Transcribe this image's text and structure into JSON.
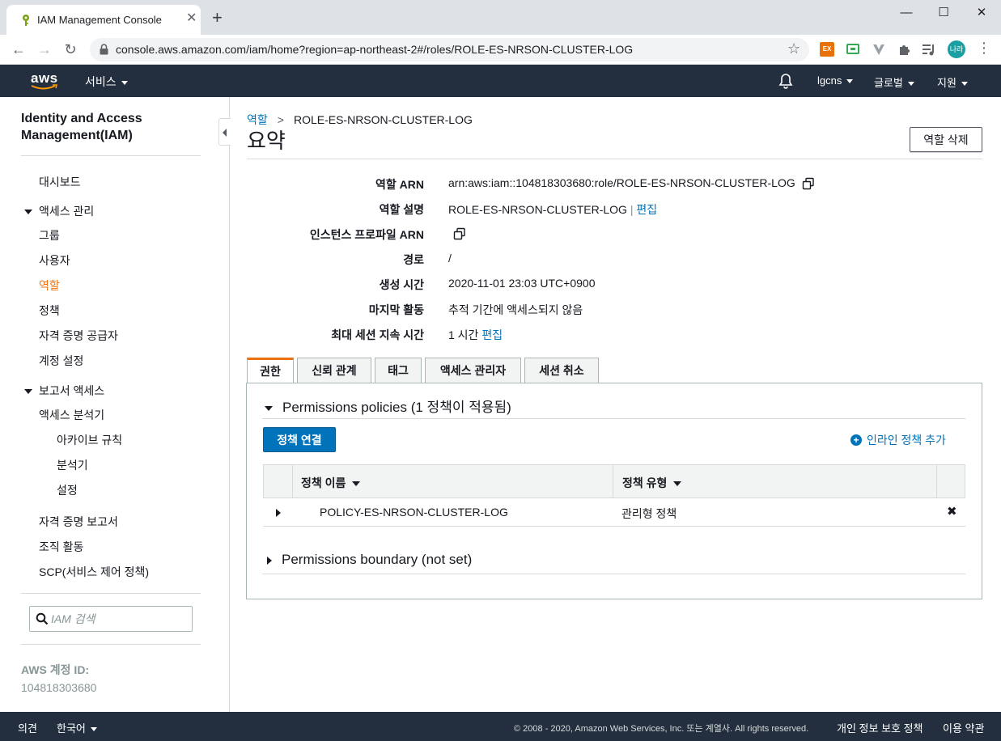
{
  "browser": {
    "tab_title": "IAM Management Console",
    "new_tab": "+",
    "url": "console.aws.amazon.com/iam/home?region=ap-northeast-2#/roles/ROLE-ES-NRSON-CLUSTER-LOG",
    "profile_initials": "나라",
    "ext_badge": "EX"
  },
  "aws_header": {
    "logo": "aws",
    "services": "서비스",
    "account": "lgcns",
    "region": "글로벌",
    "support": "지원"
  },
  "sidebar": {
    "title": "Identity and Access Management(IAM)",
    "dashboard": "대시보드",
    "access_mgmt": {
      "label": "액세스 관리",
      "items": [
        "그룹",
        "사용자",
        "역할",
        "정책",
        "자격 증명 공급자",
        "계정 설정"
      ]
    },
    "report_access": {
      "label": "보고서 액세스",
      "analyzer": "액세스 분석기",
      "sub_items": [
        "아카이브 규칙",
        "분석기",
        "설정"
      ],
      "items": [
        "자격 증명 보고서",
        "조직 활동",
        "SCP(서비스 제어 정책)"
      ]
    },
    "search_placeholder": "IAM 검색",
    "account_id_label": "AWS 계정 ID:",
    "account_id": "104818303680"
  },
  "breadcrumb": {
    "parent": "역할",
    "separator": ">",
    "current": "ROLE-ES-NRSON-CLUSTER-LOG"
  },
  "page_title": "요약",
  "delete_button": "역할 삭제",
  "summary": {
    "arn_label": "역할 ARN",
    "arn_value": "arn:aws:iam::104818303680:role/ROLE-ES-NRSON-CLUSTER-LOG",
    "desc_label": "역할 설명",
    "desc_value": "ROLE-ES-NRSON-CLUSTER-LOG",
    "desc_sep": "|",
    "edit": "편집",
    "instance_profile_label": "인스턴스 프로파일 ARN",
    "path_label": "경로",
    "path_value": "/",
    "created_label": "생성 시간",
    "created_value": "2020-11-01 23:03 UTC+0900",
    "last_activity_label": "마지막 활동",
    "last_activity_value": "추적 기간에 액세스되지 않음",
    "max_session_label": "최대 세션 지속 시간",
    "max_session_value": "1 시간",
    "max_session_edit": "편집"
  },
  "tabs": [
    "권한",
    "신뢰 관계",
    "태그",
    "액세스 관리자",
    "세션 취소"
  ],
  "permissions": {
    "policies_header": "Permissions policies (1 정책이 적용됨)",
    "attach_button": "정책 연결",
    "add_inline": "인라인 정책 추가",
    "table": {
      "col_name": "정책 이름",
      "col_type": "정책 유형",
      "rows": [
        {
          "name": "POLICY-ES-NRSON-CLUSTER-LOG",
          "type": "관리형 정책"
        }
      ]
    },
    "boundary_header": "Permissions boundary (not set)"
  },
  "footer": {
    "feedback": "의견",
    "language": "한국어",
    "copyright": "© 2008 - 2020, Amazon Web Services, Inc. 또는 계열사. All rights reserved.",
    "privacy": "개인 정보 보호 정책",
    "terms": "이용 약관"
  },
  "colors": {
    "aws_header": "#232f3e",
    "active_orange": "#ec7211",
    "link_blue": "#0073bb"
  }
}
